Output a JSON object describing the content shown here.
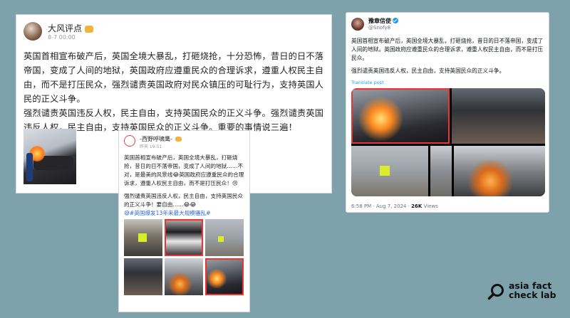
{
  "post_a": {
    "author": "大风评点",
    "timestamp": "8-7 00:00",
    "paragraphs": [
      "英国首相宣布破产后，英国全境大暴乱，打砸烧抢，十分恐怖，昔日的日不落帝国，变成了人间的地狱，英国政府应遵重民众的合理诉求，遵重人权民主自由，而不是打压民众，强烈谴责英国政府对民众镇压的可耻行为，支持英国人民的正义斗争。",
      "强烈谴责英国违反人权，民主自由，支持英国民众的正义斗争。强烈谴责英国违反人权，民主自由，支持英国民众的正义斗争。重要的事情说三遍！"
    ]
  },
  "post_b": {
    "author": "-西野呼啸鹰-",
    "timestamp": "昨天 19:51",
    "paragraphs": [
      "英国首相宣布破产后，英国全境大暴乱，打砸烧抢，昔日的日不落帝国，变成了人间的地狱……不对，是最美的风景线😂英国政府应遵重民众的合理诉求，遵重人权民主自由，而不是打压民众！😢",
      "强烈谴责英国违反人权，民主自由，支持英国民众的正义斗争！要自由……😂😂"
    ],
    "hashtag": "😅#英国爆发13年来最大规模骚乱#"
  },
  "post_c": {
    "display_name": "豫章信使",
    "handle": "@Snofy8",
    "paragraphs": [
      "英国首相宣布破产后，英国全境大暴乱，打砸烧抢，昔日的日不落帝国，变成了人间的地狱。英国政府应遵重民众的合理诉求，遵重人权民主自由，而不是打压民众。",
      "强烈谴责英国违反人权，民主自由，支持英国民众的正义斗争。"
    ],
    "translate_label": "Translate post",
    "time": "6:58 PM · Aug 7, 2024 · ",
    "views": "26K",
    "views_label": " Views"
  },
  "logo": {
    "line1": "asia fact",
    "line2": "check lab"
  },
  "colors": {
    "background": "#7ea2ac",
    "highlight_box": "#ee3333",
    "link": "#1d9bf0"
  }
}
